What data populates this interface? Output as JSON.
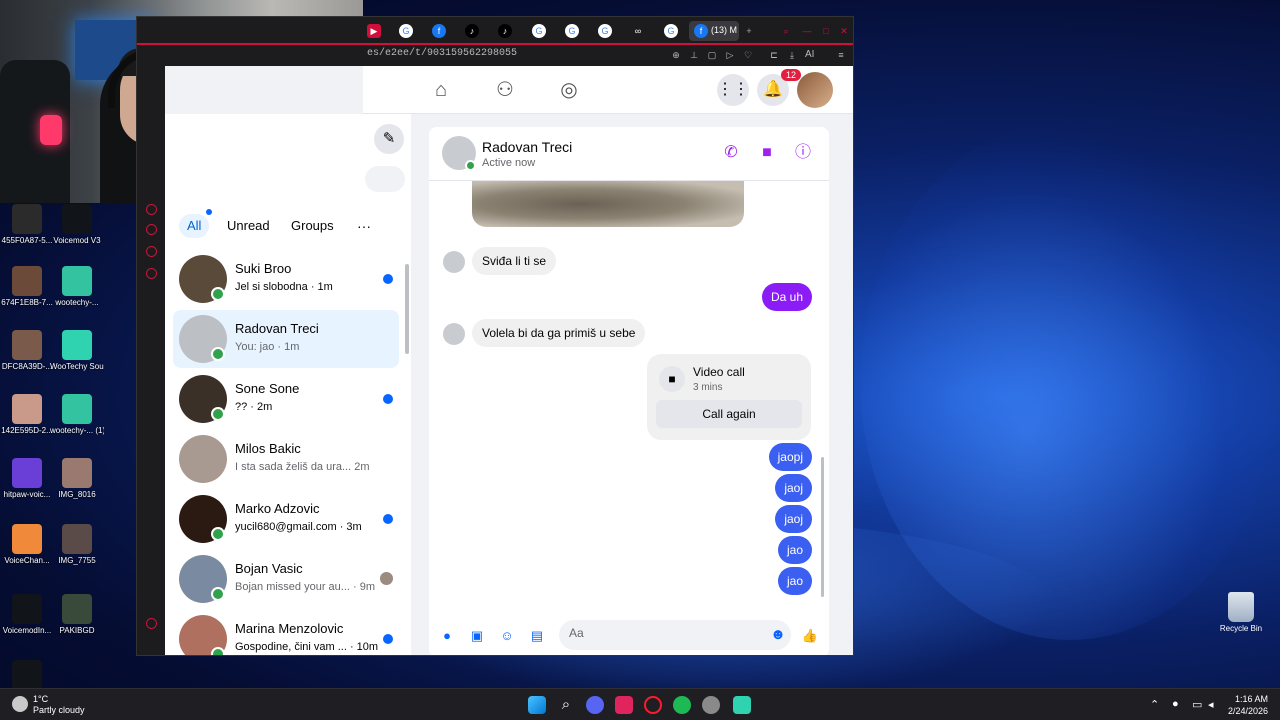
{
  "browser": {
    "active_tab_title": "(13) M",
    "url": "es/e2ee/t/903159562298055",
    "extension_label": "AI"
  },
  "desktop": {
    "icons": [
      {
        "label": "455F0A87-5...",
        "color": "#2b2b2b"
      },
      {
        "label": "Voicemod V3",
        "color": "#111418"
      },
      {
        "label": "674F1E8B-7...",
        "color": "#6b4a3a"
      },
      {
        "label": "wootechy-...",
        "color": "#34c3a1"
      },
      {
        "label": "DFC8A39D-...",
        "color": "#7a5a4a"
      },
      {
        "label": "WooTechy SoundBot",
        "color": "#2fd3b0"
      },
      {
        "label": "142E595D-2...",
        "color": "#c99a8a"
      },
      {
        "label": "wootechy-... (1)",
        "color": "#34c3a1"
      },
      {
        "label": "hitpaw-voic...",
        "color": "#6a3fd8"
      },
      {
        "label": "IMG_8016",
        "color": "#9a7a70"
      },
      {
        "label": "VoiceChan...",
        "color": "#f08a3a"
      },
      {
        "label": "IMG_7755",
        "color": "#5a4a48"
      },
      {
        "label": "VoicemodIn...",
        "color": "#111418"
      },
      {
        "label": "PAKIBGD",
        "color": "#3a4a3a"
      },
      {
        "label": "",
        "color": "#111418"
      }
    ],
    "recycle_bin": "Recycle Bin"
  },
  "facebook": {
    "notification_count": "12"
  },
  "chat_list": {
    "filters": [
      "All",
      "Unread",
      "Groups"
    ],
    "active_filter": "All",
    "more_label": "···",
    "conversations": [
      {
        "name": "Suki Broo",
        "preview": "Jel si slobodna · 1m",
        "unread": true,
        "online": true,
        "avatar_color": "#5a4a3a"
      },
      {
        "name": "Radovan Treci",
        "preview": "You: jao · 1m",
        "unread": false,
        "online": true,
        "avatar_color": "#bcc0c4",
        "selected": true
      },
      {
        "name": "Sone Sone",
        "preview": "?? · 2m",
        "unread": true,
        "online": true,
        "avatar_color": "#3a3028"
      },
      {
        "name": "Milos Bakic",
        "preview": "I sta sada želiš da ura...  2m",
        "unread": false,
        "online": false,
        "avatar_color": "#a89a90"
      },
      {
        "name": "Marko Adzovic",
        "preview": "yucil680@gmail.com · 3m",
        "unread": true,
        "online": true,
        "avatar_color": "#2a1a12"
      },
      {
        "name": "Bojan Vasic",
        "preview": "Bojan missed your au... · 9m",
        "unread": false,
        "online": true,
        "avatar_color": "#7a8aa0"
      },
      {
        "name": "Marina Menzolovic",
        "preview": "Gospodine, čini vam ... · 10m",
        "unread": true,
        "online": true,
        "avatar_color": "#b07060"
      }
    ]
  },
  "conversation": {
    "contact_name": "Radovan Treci",
    "status": "Active now",
    "messages": [
      {
        "dir": "in",
        "text": "Sviđa li ti se"
      },
      {
        "dir": "out",
        "text": "Da uh",
        "color": "#8b1cf6"
      },
      {
        "dir": "in",
        "text": "Volela bi da ga primiš u sebe"
      },
      {
        "dir": "out",
        "text": "jaopj",
        "color": "#3b5ff0"
      },
      {
        "dir": "out",
        "text": "jaoj",
        "color": "#3b5ff0"
      },
      {
        "dir": "out",
        "text": "jaoj",
        "color": "#3b5ff0"
      },
      {
        "dir": "out",
        "text": "jao",
        "color": "#3b5ff0"
      },
      {
        "dir": "out",
        "text": "jao",
        "color": "#3b5ff0"
      }
    ],
    "call_card": {
      "title": "Video call",
      "duration": "3 mins",
      "action": "Call again"
    },
    "composer_placeholder": "Aa"
  },
  "taskbar": {
    "temperature": "1°C",
    "weather": "Partly cloudy",
    "time": "1:16 AM",
    "date": "2/24/2026"
  }
}
